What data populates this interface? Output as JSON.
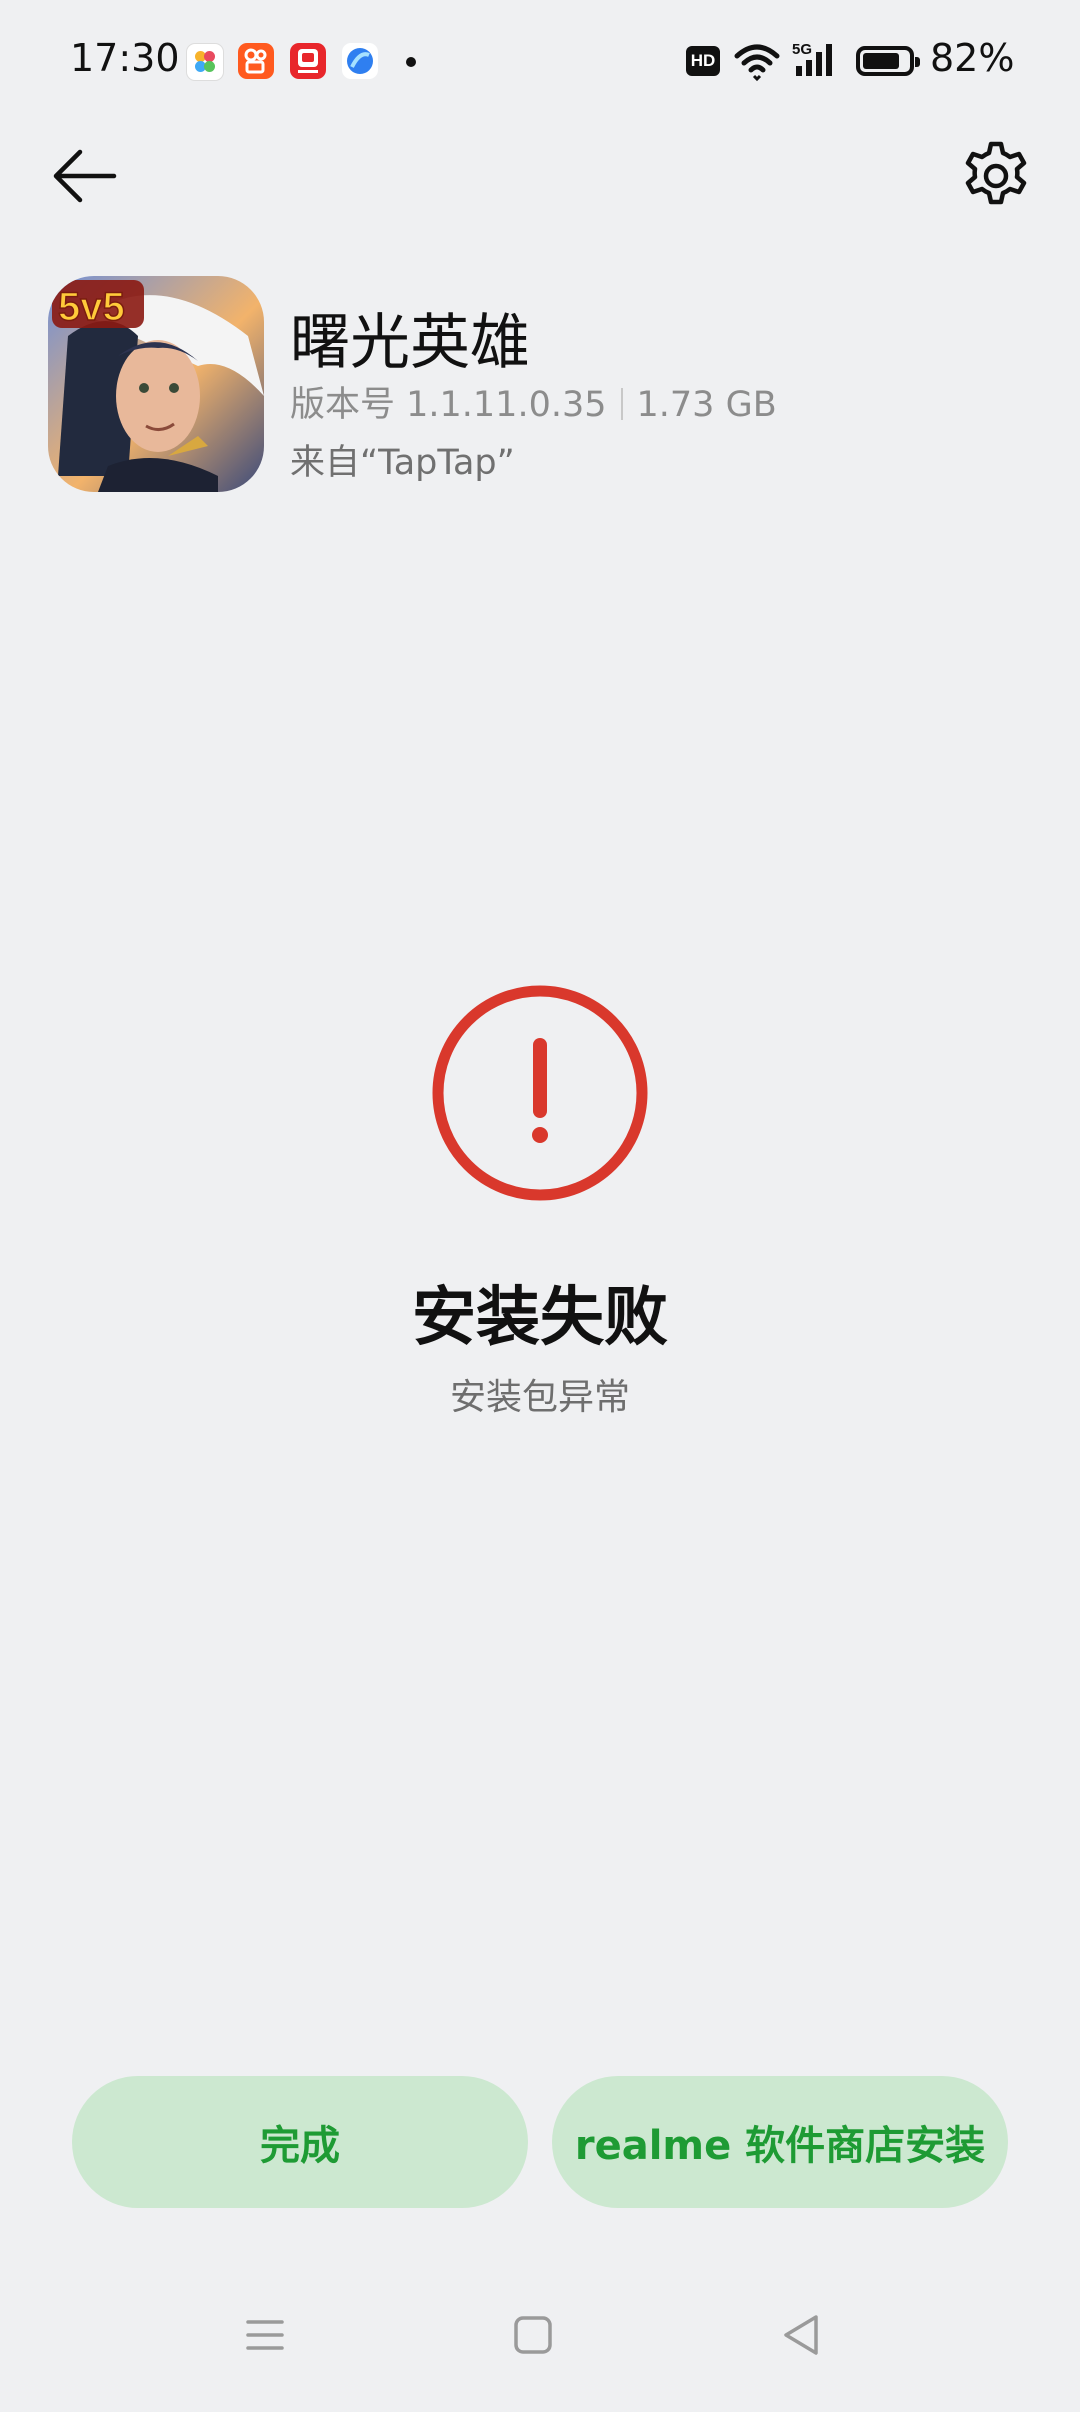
{
  "status_bar": {
    "time": "17:30",
    "notification_icons": [
      "photos-app-icon",
      "kuaishou-app-icon",
      "pinduoduo-app-icon",
      "browser-app-icon"
    ],
    "hd_label": "HD",
    "network_label": "5G",
    "battery_percent": "82%",
    "battery_level": 0.82
  },
  "header": {
    "back_icon": "arrow-left-icon",
    "settings_icon": "gear-icon"
  },
  "app": {
    "name": "曙光英雄",
    "version": "版本号 1.1.11.0.35",
    "size": "1.73 GB",
    "source": "来自“TapTap”",
    "icon_badge": "5v5"
  },
  "result": {
    "status_icon": "error-exclamation-icon",
    "title": "安装失败",
    "subtitle": "安装包异常"
  },
  "buttons": {
    "done": "完成",
    "store_install": "realme 软件商店安装"
  },
  "navigation": {
    "items": [
      "menu-icon",
      "home-icon",
      "back-triangle-icon"
    ]
  },
  "colors": {
    "background": "#eff0f2",
    "error_red": "#d9382c",
    "button_bg": "#cce8d0",
    "button_text": "#1e9b34"
  }
}
